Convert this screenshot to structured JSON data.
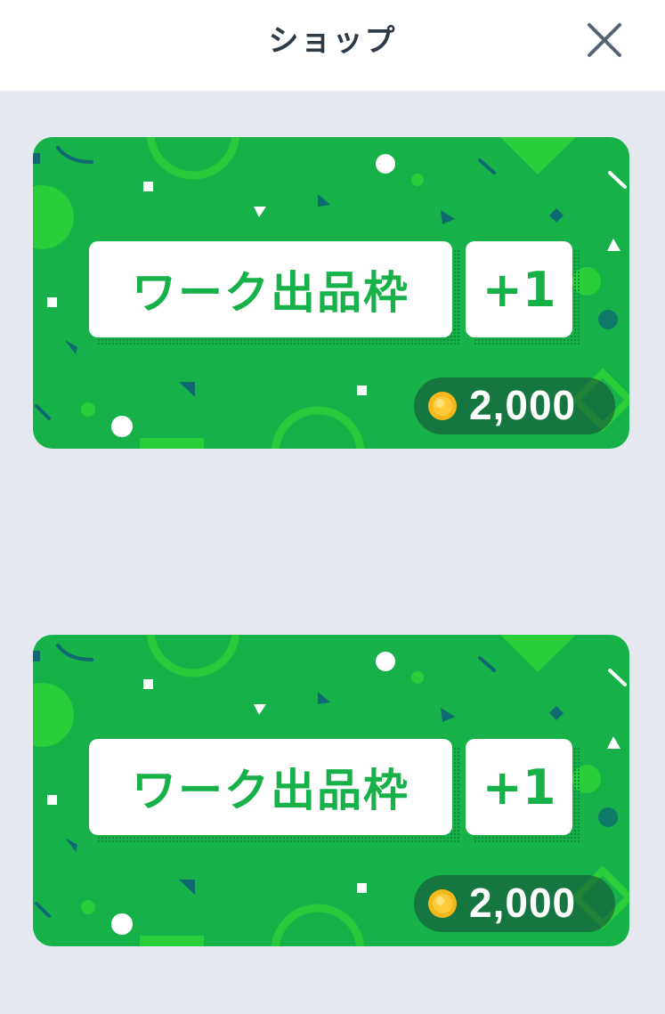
{
  "header": {
    "title": "ショップ",
    "close_icon": "close-icon"
  },
  "products": [
    {
      "label": "ワーク出品枠",
      "quantity": "+1",
      "price": "2,000",
      "price_icon": "coin-icon"
    },
    {
      "label": "ワーク出品枠",
      "quantity": "+1",
      "price": "2,000",
      "price_icon": "coin-icon"
    }
  ],
  "colors": {
    "card_green": "#17b14a",
    "page_bg": "#e5e9ef",
    "title_text": "#2f3a47",
    "coin": "#f5b81c"
  }
}
